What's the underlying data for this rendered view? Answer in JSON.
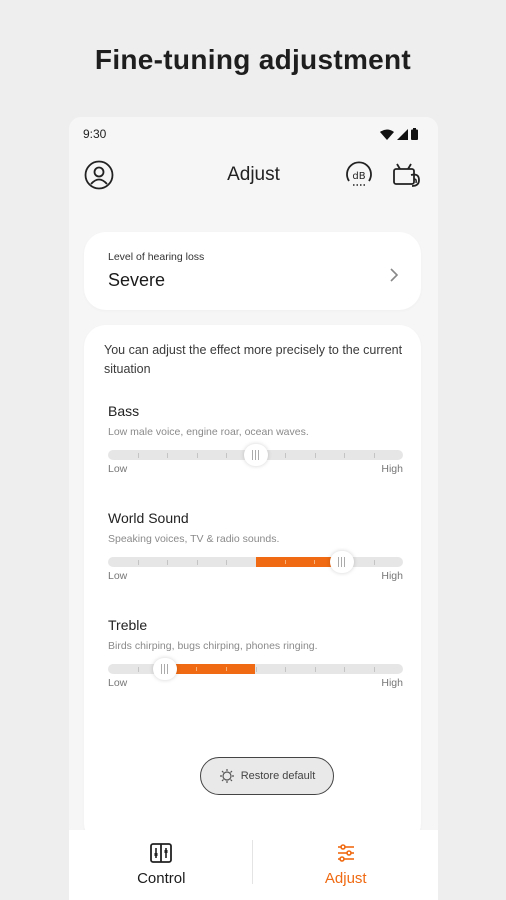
{
  "headline": "Fine-tuning adjustment",
  "status_bar": {
    "time": "9:30"
  },
  "header": {
    "title": "Adjust",
    "profile_icon": "profile-icon",
    "db_icon": "db-meter-icon",
    "device_icon": "device-icon"
  },
  "hearing_loss": {
    "label": "Level of hearing loss",
    "value": "Severe"
  },
  "adjust": {
    "intro": "You can adjust the effect more precisely to the current situation",
    "sliders": [
      {
        "name": "Bass",
        "description": "Low male voice, engine roar, ocean waves.",
        "low": "Low",
        "high": "High",
        "level": 0.5,
        "fill_from": 0.5,
        "fill_to": 0.5
      },
      {
        "name": "World Sound",
        "description": "Speaking voices, TV & radio sounds.",
        "low": "Low",
        "high": "High",
        "level": 0.792,
        "fill_from": 0.5,
        "fill_to": 0.792
      },
      {
        "name": "Treble",
        "description": "Birds chirping, bugs chirping, phones ringing.",
        "low": "Low",
        "high": "High",
        "level": 0.193,
        "fill_from": 0.193,
        "fill_to": 0.5
      }
    ],
    "restore_label": "Restore default"
  },
  "tabs": [
    {
      "label": "Control",
      "active": false,
      "color": "#1b1b1b"
    },
    {
      "label": "Adjust",
      "active": true,
      "color": "#ef6a12"
    }
  ],
  "colors": {
    "accent": "#ef6a12",
    "background": "#eeeeee",
    "card": "#ffffff"
  }
}
